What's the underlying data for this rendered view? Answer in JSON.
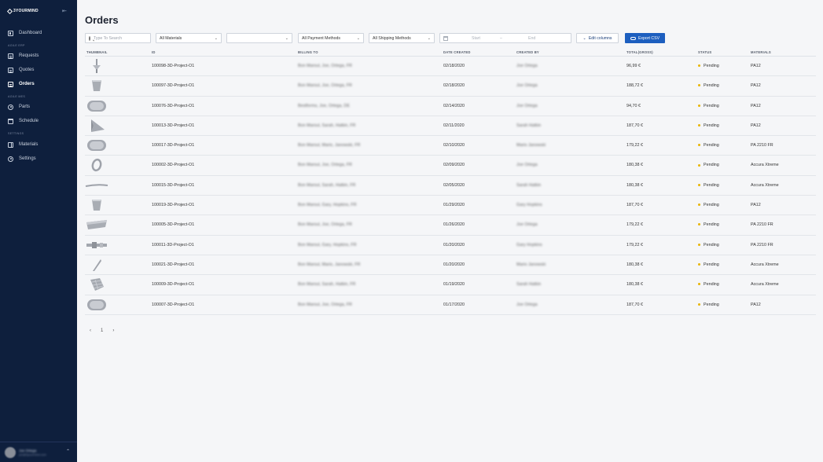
{
  "app": {
    "brand": "3YOURMIND",
    "collapse_glyph": "⇤",
    "primary_color": "#0e1f3d",
    "accent_color": "#1d5fbf",
    "pending_color": "#e8b400"
  },
  "sidebar": {
    "items": [
      {
        "label": "Dashboard",
        "icon": "dashboard-icon"
      },
      {
        "label": "Requests",
        "icon": "requests-icon"
      },
      {
        "label": "Quotes",
        "icon": "quotes-icon"
      },
      {
        "label": "Orders",
        "icon": "orders-icon",
        "active": true
      },
      {
        "label": "Parts",
        "icon": "parts-icon"
      },
      {
        "label": "Schedule",
        "icon": "schedule-icon"
      },
      {
        "label": "Materials",
        "icon": "materials-icon"
      },
      {
        "label": "Settings",
        "icon": "settings-icon"
      }
    ],
    "sections": [
      "AGILE ERP",
      "AGILE MES",
      "SETTINGS"
    ],
    "user": {
      "name": "Joe Ortega",
      "email": "joe@3yourmind.com",
      "chevron": "⌃"
    }
  },
  "main": {
    "title": "Orders",
    "filters": {
      "search_placeholder": "Type To Search",
      "materials": "All Materials",
      "empty_select": "",
      "payment": "All Payment Methods",
      "shipping": "All Shipping Methods",
      "date_start": "Start",
      "date_sep": "–",
      "date_end": "End",
      "chevron": "⌄"
    },
    "edit_columns_label": "Edit columns",
    "export_label": "Export CSV",
    "columns": [
      "THUMBNAIL",
      "ID",
      "BILLING TO",
      "DATE CREATED",
      "CREATED BY",
      "TOTAL(GROSS)",
      "STATUS",
      "MATERIALS"
    ],
    "rows": [
      {
        "thumb": "pin",
        "id": "100098-3D-Project-O1",
        "billing": "Bon Maroul, Joe, Ortega, FR",
        "date": "02/18/2020",
        "created_by": "Joe Ortega",
        "total": "96,99 €",
        "status": "Pending",
        "material": "PA12"
      },
      {
        "thumb": "cup",
        "id": "100097-3D-Project-O1",
        "billing": "Bon Maroul, Joe, Ortega, FR",
        "date": "02/18/2020",
        "created_by": "Joe Ortega",
        "total": "188,72 €",
        "status": "Pending",
        "material": "PA12"
      },
      {
        "thumb": "tray",
        "id": "100076-3D-Project-O1",
        "billing": "Bestforms, Joe, Ortega, DE",
        "date": "02/14/2020",
        "created_by": "Joe Ortega",
        "total": "94,70 €",
        "status": "Pending",
        "material": "PA12"
      },
      {
        "thumb": "fin",
        "id": "100013-3D-Project-O1",
        "billing": "Bon Maroul, Sarah, Hatkin, FR",
        "date": "02/11/2020",
        "created_by": "Sarah Hatkin",
        "total": "187,70 €",
        "status": "Pending",
        "material": "PA12"
      },
      {
        "thumb": "tray",
        "id": "100017-3D-Project-O1",
        "billing": "Bon Maroul, Mario, Janowski, FR",
        "date": "02/10/2020",
        "created_by": "Mario Janowski",
        "total": "179,22 €",
        "status": "Pending",
        "material": "PA 2210 FR"
      },
      {
        "thumb": "ring",
        "id": "100002-3D-Project-O1",
        "billing": "Bon Maroul, Joe, Ortega, FR",
        "date": "02/09/2020",
        "created_by": "Joe Ortega",
        "total": "180,38 €",
        "status": "Pending",
        "material": "Accura Xtreme"
      },
      {
        "thumb": "rod",
        "id": "100015-3D-Project-O1",
        "billing": "Bon Maroul, Sarah, Hatkin, FR",
        "date": "02/05/2020",
        "created_by": "Sarah Hatkin",
        "total": "180,38 €",
        "status": "Pending",
        "material": "Accura Xtreme"
      },
      {
        "thumb": "cup",
        "id": "100019-3D-Project-O1",
        "billing": "Bon Maroul, Gary, Hopkins, FR",
        "date": "01/29/2020",
        "created_by": "Gary Hopkins",
        "total": "187,70 €",
        "status": "Pending",
        "material": "PA12"
      },
      {
        "thumb": "plate",
        "id": "100005-3D-Project-O1",
        "billing": "Bon Maroul, Joe, Ortega, FR",
        "date": "01/26/2020",
        "created_by": "Joe Ortega",
        "total": "179,22 €",
        "status": "Pending",
        "material": "PA 2210 FR"
      },
      {
        "thumb": "bar",
        "id": "100011-3D-Project-O1",
        "billing": "Bon Maroul, Gary, Hopkins, FR",
        "date": "01/20/2020",
        "created_by": "Gary Hopkins",
        "total": "179,22 €",
        "status": "Pending",
        "material": "PA 2210 FR"
      },
      {
        "thumb": "blade",
        "id": "100021-3D-Project-O1",
        "billing": "Bon Maroul, Mario, Janowski, FR",
        "date": "01/20/2020",
        "created_by": "Mario Janowski",
        "total": "180,38 €",
        "status": "Pending",
        "material": "Accura Xtreme"
      },
      {
        "thumb": "mesh",
        "id": "100009-3D-Project-O1",
        "billing": "Bon Maroul, Sarah, Hatkin, FR",
        "date": "01/19/2020",
        "created_by": "Sarah Hatkin",
        "total": "180,38 €",
        "status": "Pending",
        "material": "Accura Xtreme"
      },
      {
        "thumb": "tray",
        "id": "100007-3D-Project-O1",
        "billing": "Bon Maroul, Joe, Ortega, FR",
        "date": "01/17/2020",
        "created_by": "Joe Ortega",
        "total": "187,70 €",
        "status": "Pending",
        "material": "PA12"
      }
    ],
    "pagination": {
      "prev": "‹",
      "page": "1",
      "next": "›"
    }
  }
}
